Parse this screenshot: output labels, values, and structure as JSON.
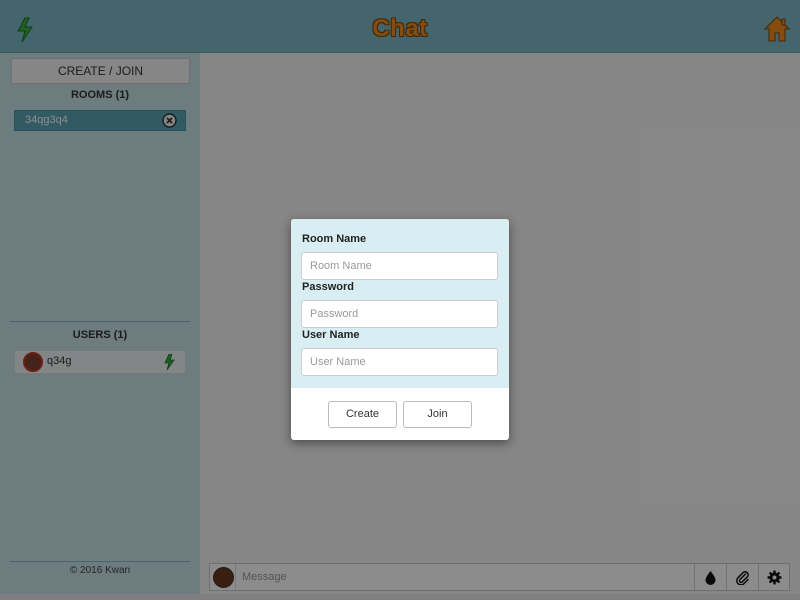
{
  "header": {
    "title": "Chat",
    "left_icon": "lightning-bolt-icon",
    "right_icon": "home-icon",
    "title_color": "#f08a1c",
    "background": "#7fb8c6"
  },
  "sidebar": {
    "create_join_label": "CREATE / JOIN",
    "rooms_heading": "ROOMS (1)",
    "rooms": [
      {
        "name": "34qg3q4",
        "close_icon": "close-circle-icon"
      }
    ],
    "users_heading": "USERS (1)",
    "users": [
      {
        "name": "q34g",
        "status_icon": "lightning-bolt-icon"
      }
    ],
    "footer": "© 2016 Kwan"
  },
  "message_bar": {
    "placeholder": "Message",
    "buttons": [
      "drop-icon",
      "paperclip-icon",
      "gear-icon"
    ]
  },
  "modal": {
    "room_name_label": "Room Name",
    "room_name_placeholder": "Room Name",
    "password_label": "Password",
    "password_placeholder": "Password",
    "user_name_label": "User Name",
    "user_name_placeholder": "User Name",
    "create_label": "Create",
    "join_label": "Join"
  },
  "colors": {
    "accent": "#5ba5b8",
    "sidebar": "#c5e2e8",
    "modal_form": "#d9eef3",
    "bolt": "#3cb043"
  }
}
